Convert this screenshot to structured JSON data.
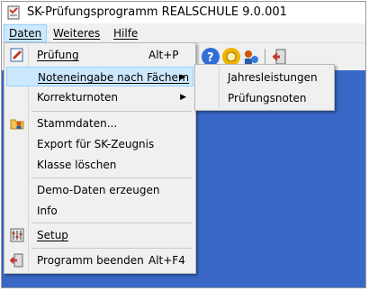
{
  "window": {
    "title": "SK-Prüfungsprogramm REALSCHULE 9.0.001"
  },
  "menubar": {
    "items": [
      {
        "label": "Daten"
      },
      {
        "label": "Weiteres"
      },
      {
        "label": "Hilfe"
      }
    ]
  },
  "daten_menu": {
    "items": [
      {
        "label": "Prüfung",
        "shortcut": "Alt+P",
        "icon": "exam-edit-icon"
      },
      {
        "label": "Noteneingabe nach Fächern",
        "submenu": true,
        "highlighted": true
      },
      {
        "label": "Korrekturnoten",
        "submenu": true
      },
      {
        "label": "Stammdaten...",
        "icon": "folder-person-icon"
      },
      {
        "label": "Export für SK-Zeugnis"
      },
      {
        "label": "Klasse löschen"
      },
      {
        "label": "Demo-Daten erzeugen"
      },
      {
        "label": "Info"
      },
      {
        "label": "Setup",
        "icon": "setup-sliders-icon"
      },
      {
        "label": "Programm beenden",
        "shortcut": "Alt+F4",
        "icon": "exit-door-icon"
      }
    ]
  },
  "submenu": {
    "items": [
      {
        "label": "Jahresleistungen"
      },
      {
        "label": "Prüfungsnoten"
      }
    ]
  },
  "colors": {
    "workspace": "#3968c8",
    "highlight": "#cce8ff",
    "highlight_border": "#99d1ff"
  }
}
